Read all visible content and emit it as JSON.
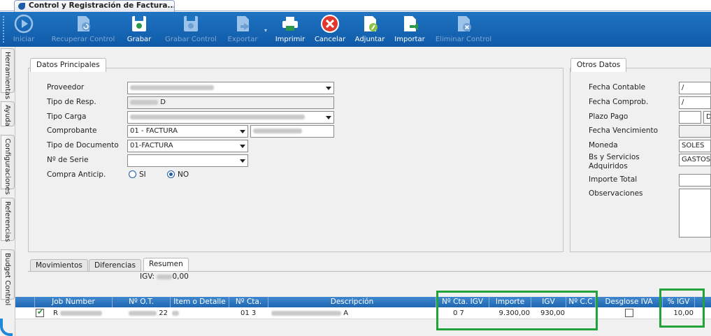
{
  "window": {
    "title": "Control y Registración de Factura..."
  },
  "toolbar": {
    "buttons": [
      {
        "label": "Iniciar",
        "icon": "play-icon",
        "enabled": false
      },
      {
        "label": "Recuperar Control",
        "icon": "document-recover-icon",
        "enabled": false
      },
      {
        "label": "Grabar",
        "icon": "save-icon",
        "enabled": true
      },
      {
        "label": "Grabar Control",
        "icon": "save-control-icon",
        "enabled": false
      },
      {
        "label": "Exportar",
        "icon": "export-icon",
        "enabled": false
      },
      {
        "label": "Imprimir",
        "icon": "printer-icon",
        "enabled": true
      },
      {
        "label": "Cancelar",
        "icon": "cancel-icon",
        "enabled": true
      },
      {
        "label": "Adjuntar",
        "icon": "attach-icon",
        "enabled": true
      },
      {
        "label": "Importar",
        "icon": "import-icon",
        "enabled": true
      },
      {
        "label": "Eliminar Control",
        "icon": "delete-control-icon",
        "enabled": false
      }
    ]
  },
  "side_tabs": [
    "Herramientas",
    "Ayuda",
    "Configuraciones",
    "Referencias",
    "Budget Control"
  ],
  "datos_principales": {
    "tab": "Datos Principales",
    "labels": {
      "proveedor": "Proveedor",
      "tipo_resp": "Tipo de Resp.",
      "tipo_carga": "Tipo Carga",
      "comprobante": "Comprobante",
      "tipo_documento": "Tipo de Documento",
      "n_serie": "Nº de Serie",
      "compra_anticip": "Compra Anticip."
    },
    "values": {
      "proveedor": "",
      "tipo_resp": "D",
      "tipo_carga": "",
      "comprobante": "01 - FACTURA",
      "comprobante_numero": "",
      "tipo_documento": "01-FACTURA",
      "n_serie": ""
    },
    "radio_si": "SI",
    "radio_no": "NO"
  },
  "otros_datos": {
    "tab": "Otros Datos",
    "labels": {
      "fecha_contable": "Fecha Contable",
      "fecha_comprob": "Fecha Comprob.",
      "plazo_pago": "Plazo Pago",
      "fecha_vencimiento": "Fecha Vencimiento",
      "moneda": "Moneda",
      "bs_servicios": "Bs y Servicios Adquiridos",
      "importe_total": "Importe Total",
      "observaciones": "Observaciones"
    },
    "values": {
      "fecha_contable": "/",
      "fecha_comprob": "/",
      "plazo_pago": "",
      "plazo_pago_unit": "D",
      "fecha_vencimiento": "",
      "moneda": "SOLES",
      "bs_servicios": "GASTOS",
      "importe_total": ""
    }
  },
  "lower_tabs": [
    "Movimientos",
    "Diferencias",
    "Resumen"
  ],
  "resumen": {
    "igv_label": "IGV:",
    "igv_value": "0,00"
  },
  "grid": {
    "columns": [
      "",
      "Job Number",
      "Nº O.T.",
      "Item o Detalle",
      "Nº Cta.",
      "Descripción",
      "Nº Cta. IGV",
      "Importe",
      "IGV",
      "Nº C.C",
      "Desglose IVA",
      "% IGV"
    ],
    "rows": [
      {
        "selected": true,
        "job_number": "R",
        "n_ot": "22",
        "item_detalle": "",
        "n_cta": "01 3",
        "descripcion": "A",
        "n_cta_igv": "0 7",
        "importe": "9.300,00",
        "igv": "930,00",
        "n_cc": "",
        "desglose_iva": false,
        "pct_igv": "10,00"
      }
    ]
  },
  "colors": {
    "toolbar": "#1667b8",
    "grid_header": "#2f78c2",
    "highlight": "#21a33a"
  }
}
